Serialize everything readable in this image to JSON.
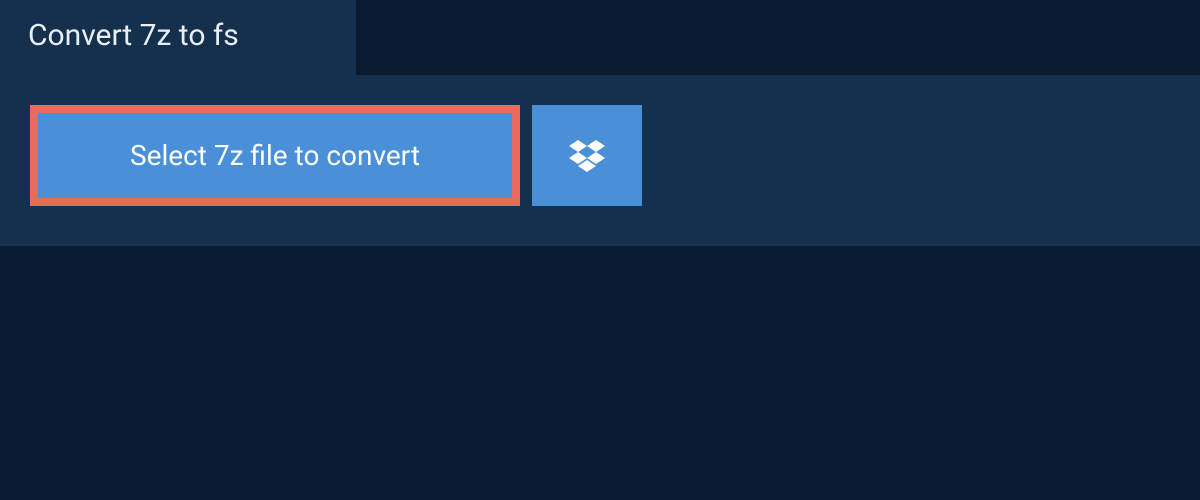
{
  "tab": {
    "title": "Convert 7z to fs"
  },
  "actions": {
    "select_label": "Select 7z file to convert"
  },
  "colors": {
    "background": "#0a1a2f",
    "panel": "#14304d",
    "button": "#4a90d9",
    "highlight_border": "#e86b5c",
    "text_light": "#ffffff",
    "text_tab": "#e8eef4"
  }
}
